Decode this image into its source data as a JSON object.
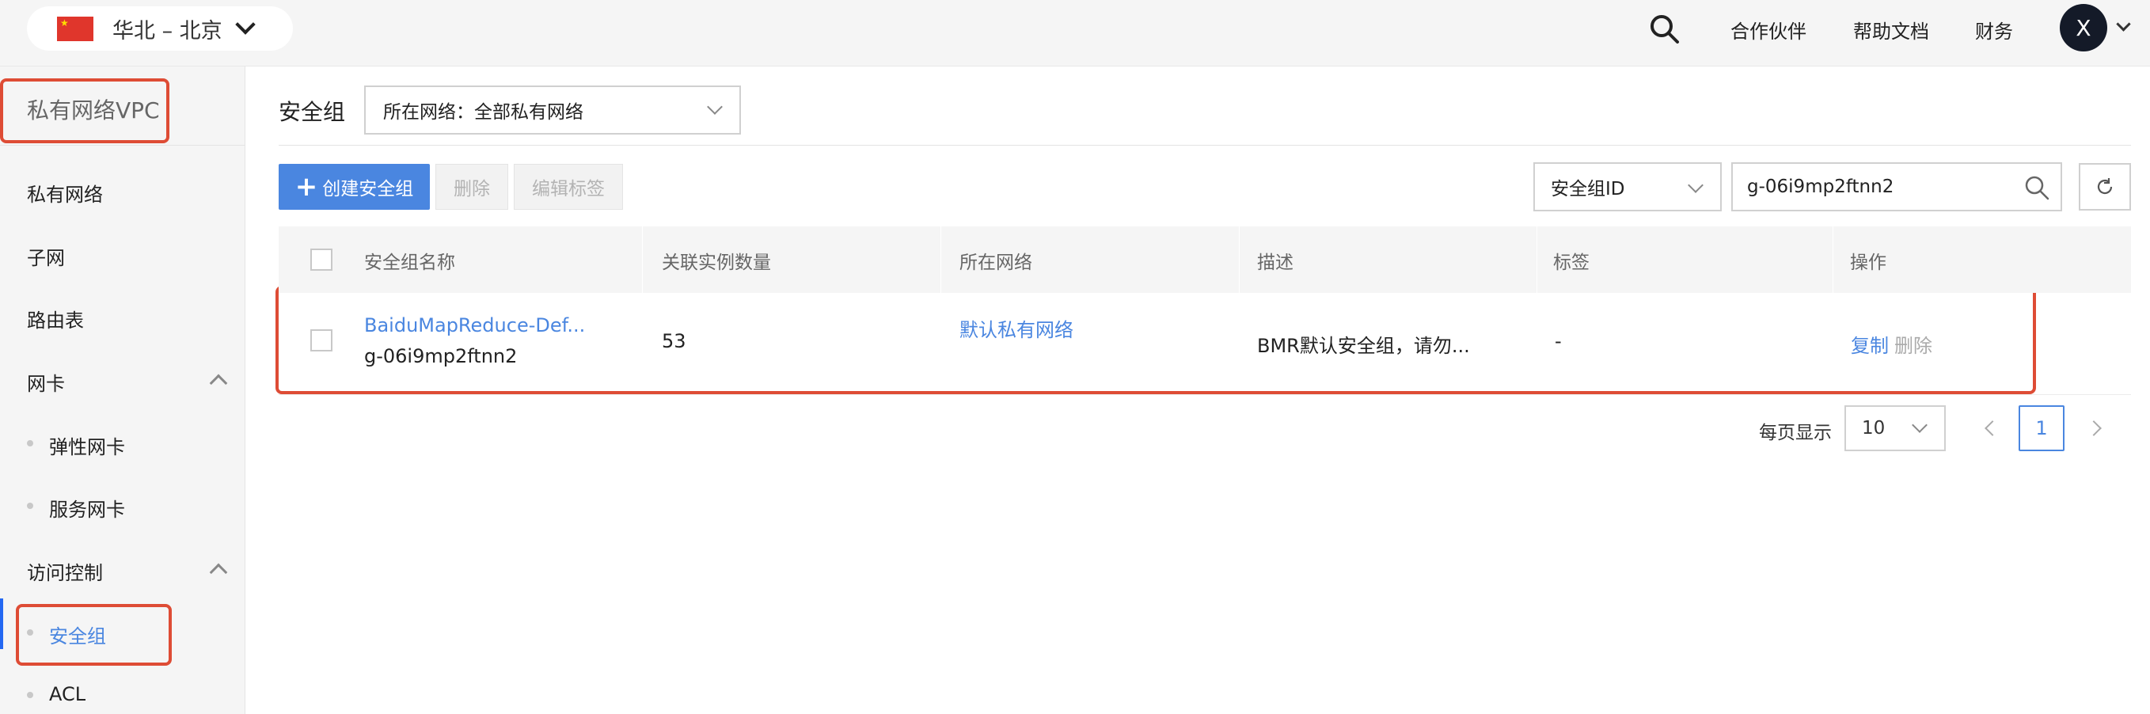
{
  "header": {
    "region": "华北 – 北京",
    "links": [
      "合作伙伴",
      "帮助文档",
      "财务"
    ],
    "avatar_initial": "X"
  },
  "sidebar": {
    "title": "私有网络VPC",
    "items": [
      "私有网络",
      "子网",
      "路由表"
    ],
    "groups": [
      {
        "label": "网卡",
        "children": [
          "弹性网卡",
          "服务网卡"
        ]
      },
      {
        "label": "访问控制",
        "children": [
          "安全组",
          "ACL"
        ]
      }
    ],
    "active": "安全组"
  },
  "main": {
    "title": "安全组",
    "network_filter": "所在网络：全部私有网络",
    "toolbar": {
      "create": "创建安全组",
      "delete": "删除",
      "edit_tags": "编辑标签"
    },
    "search": {
      "field": "安全组ID",
      "value": "g-06i9mp2ftnn2"
    },
    "table": {
      "columns": [
        "安全组名称",
        "关联实例数量",
        "所在网络",
        "描述",
        "标签",
        "操作"
      ],
      "rows": [
        {
          "name": "BaiduMapReduce-Def...",
          "id": "g-06i9mp2ftnn2",
          "instances": "53",
          "network": "默认私有网络",
          "description": "BMR默认安全组，请勿...",
          "tags": "-",
          "actions": [
            "复制",
            "删除"
          ]
        }
      ]
    },
    "pagination": {
      "page_size_label": "每页显示",
      "page_size": "10",
      "current_page": "1"
    }
  },
  "colors": {
    "accent": "#4a86e0",
    "highlight": "#de4c35",
    "avatar": "#141a28"
  }
}
